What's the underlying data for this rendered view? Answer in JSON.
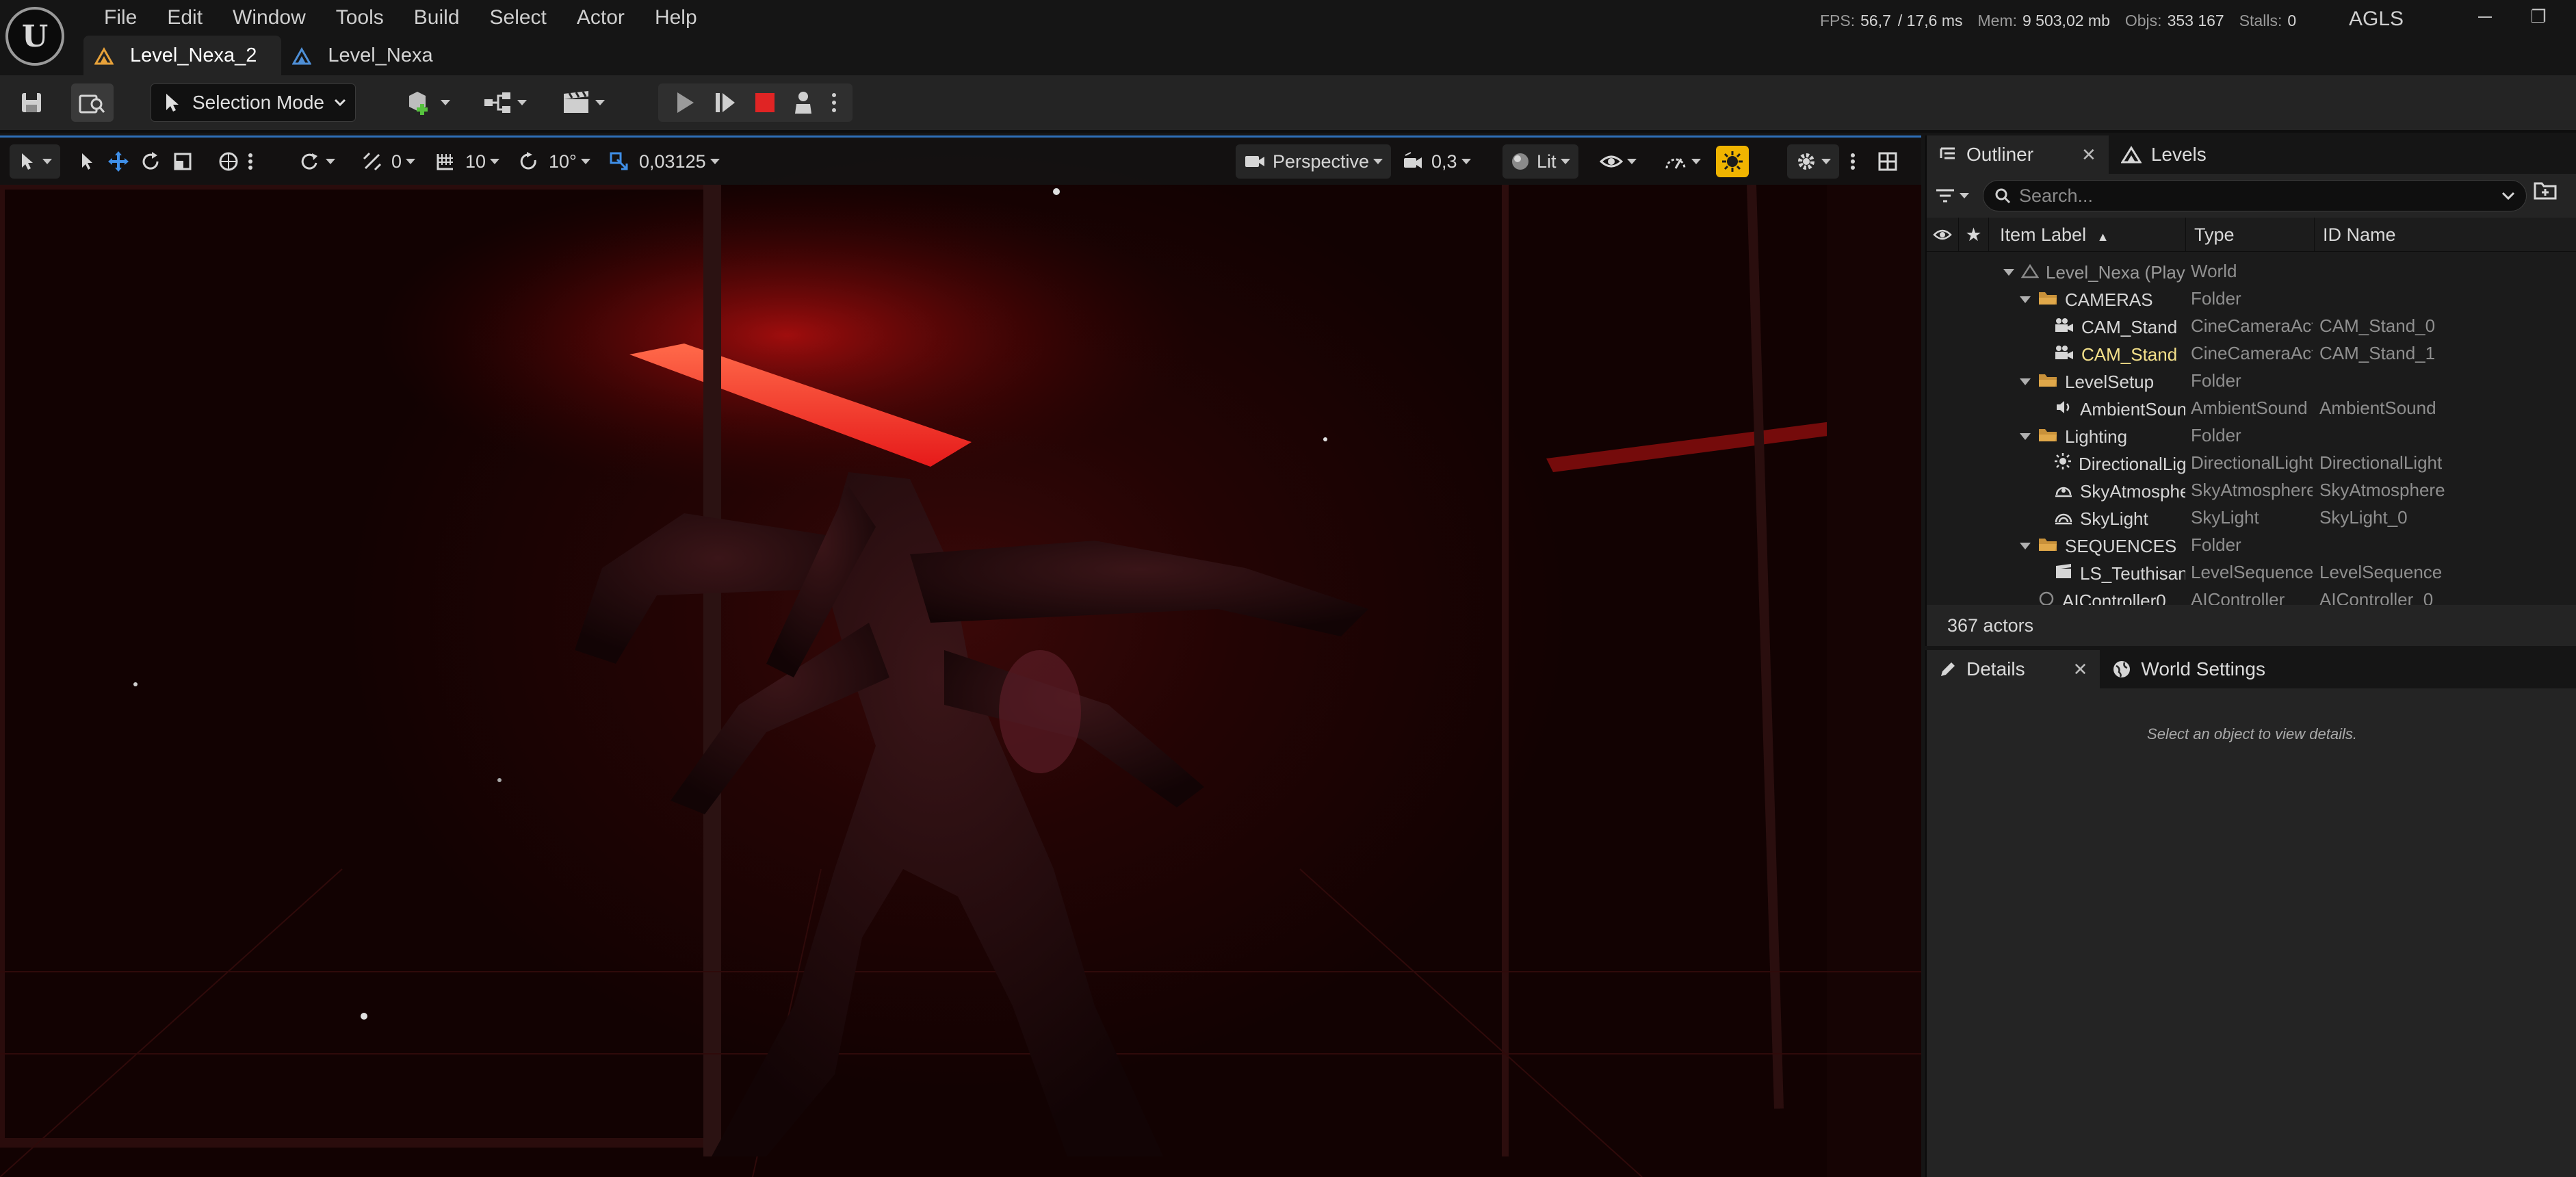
{
  "menu": [
    "File",
    "Edit",
    "Window",
    "Tools",
    "Build",
    "Select",
    "Actor",
    "Help"
  ],
  "stats": {
    "fps_label": "FPS:",
    "fps_value": "56,7",
    "ms_value": "/ 17,6 ms",
    "mem_label": "Mem:",
    "mem_value": "9 503,02 mb",
    "objs_label": "Objs:",
    "objs_value": "353 167",
    "stalls_label": "Stalls:",
    "stalls_value": "0"
  },
  "project_name": "AGLS",
  "tabs": [
    {
      "label": "Level_Nexa_2",
      "active": true
    },
    {
      "label": "Level_Nexa",
      "active": false
    }
  ],
  "toolbar": {
    "mode_label": "Selection Mode"
  },
  "viewport": {
    "rotate_snap": "0",
    "grid_snap": "10",
    "angle_snap": "10°",
    "scale_snap": "0,03125",
    "view_type": "Perspective",
    "camera_speed": "0,3",
    "view_mode": "Lit"
  },
  "outliner": {
    "tab_label": "Outliner",
    "levels_tab_label": "Levels",
    "close_glyph": "✕",
    "search_placeholder": "Search...",
    "columns": {
      "label": "Item Label",
      "type": "Type",
      "id": "ID Name"
    },
    "rows": [
      {
        "label": "Level_Nexa (Play In Editor)",
        "type": "World",
        "id": "",
        "icon": "world-icon"
      },
      {
        "label": "CAMERAS",
        "type": "Folder",
        "id": "",
        "icon": "folder-icon"
      },
      {
        "label": "CAM_Stand",
        "type": "CineCameraActor",
        "id": "CAM_Stand_0",
        "icon": "camera-icon"
      },
      {
        "label": "CAM_Stand",
        "type": "CineCameraActor",
        "id": "CAM_Stand_1",
        "icon": "camera-icon"
      },
      {
        "label": "LevelSetup",
        "type": "Folder",
        "id": "",
        "icon": "folder-icon"
      },
      {
        "label": "AmbientSound",
        "type": "AmbientSound",
        "id": "AmbientSound",
        "icon": "sound-icon"
      },
      {
        "label": "Lighting",
        "type": "Folder",
        "id": "",
        "icon": "folder-icon"
      },
      {
        "label": "DirectionalLight",
        "type": "DirectionalLight",
        "id": "DirectionalLight",
        "icon": "sun-icon"
      },
      {
        "label": "SkyAtmosphere",
        "type": "SkyAtmosphere",
        "id": "SkyAtmosphere",
        "icon": "atmosphere-icon"
      },
      {
        "label": "SkyLight",
        "type": "SkyLight",
        "id": "SkyLight_0",
        "icon": "skylight-icon"
      },
      {
        "label": "SEQUENCES",
        "type": "Folder",
        "id": "",
        "icon": "folder-icon"
      },
      {
        "label": "LS_Teuthisan_Stand",
        "type": "LevelSequenceActor",
        "id": "LevelSequence",
        "icon": "sequence-icon"
      },
      {
        "label": "AIController0",
        "type": "AIController",
        "id": "AIController_0",
        "icon": "actor-icon"
      }
    ],
    "actor_count": "367 actors"
  },
  "details": {
    "tab_label": "Details",
    "world_settings_label": "World Settings",
    "close_glyph": "✕",
    "empty_text": "Select an object to view details."
  }
}
